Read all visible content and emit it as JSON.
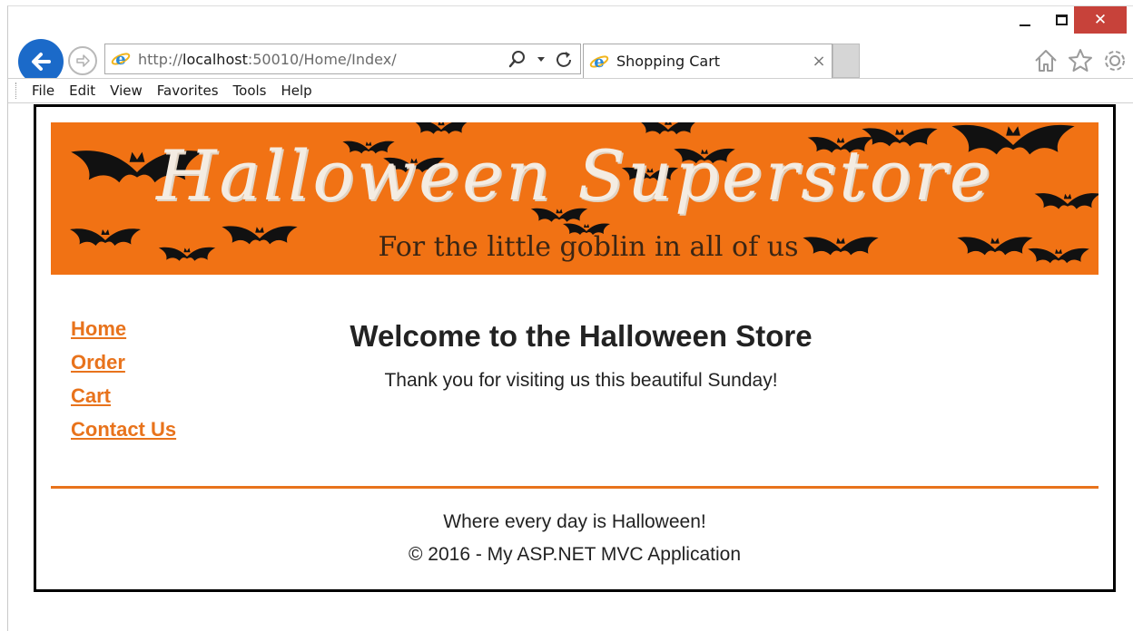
{
  "browser": {
    "address_url_prefix": "http://",
    "address_url_host": "localhost",
    "address_url_rest": ":50010/Home/Index/",
    "tab_title": "Shopping Cart",
    "tab_close": "×",
    "close_glyph": "✕",
    "icons": {
      "back": "back-arrow-icon",
      "forward": "forward-arrow-icon",
      "site": "internet-explorer-icon",
      "search": "search-icon",
      "dropdown": "chevron-down-icon",
      "refresh": "refresh-icon",
      "home": "home-icon",
      "favorites": "star-icon",
      "settings": "gear-icon"
    },
    "colors": {
      "back_button": "#1b6ac9",
      "close_button": "#c7423a"
    }
  },
  "menu": {
    "items": [
      "File",
      "Edit",
      "View",
      "Favorites",
      "Tools",
      "Help"
    ]
  },
  "site": {
    "banner_title": "Halloween Superstore",
    "banner_tagline": "For the little goblin in all of us",
    "nav": [
      "Home",
      "Order",
      "Cart",
      "Contact Us"
    ],
    "welcome_title": "Welcome to the Halloween Store",
    "welcome_text": "Thank you for visiting us this beautiful Sunday!",
    "footer_tagline": "Where every day is Halloween!",
    "footer_copyright": "© 2016 - My ASP.NET MVC Application",
    "colors": {
      "banner": "#f17214",
      "accent": "#e8731c",
      "text": "#222222"
    }
  }
}
